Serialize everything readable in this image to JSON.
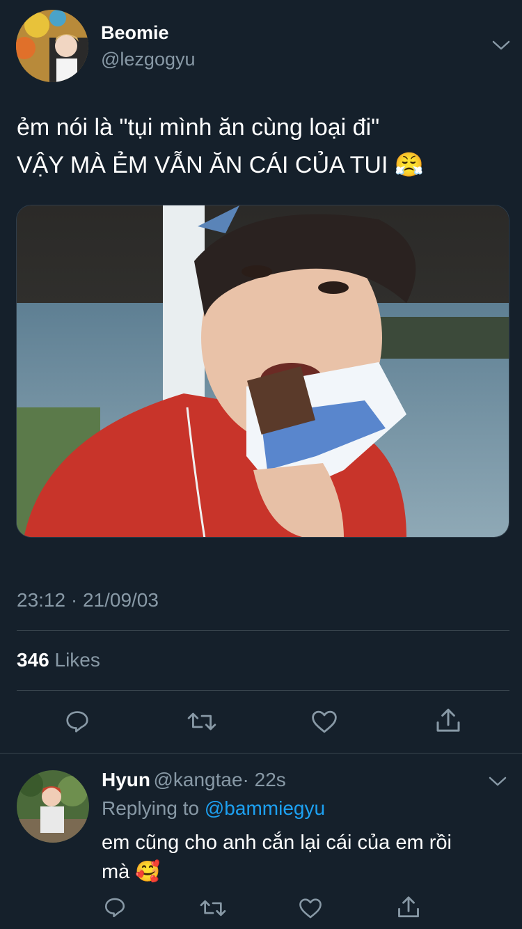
{
  "main_tweet": {
    "author_name": "Beomie",
    "author_handle": "@lezgogyu",
    "text_line1": "ẻm nói là \"tụi mình ăn cùng loại đi\"",
    "text_line2": "VẬY MÀ ẺM VẪN ĂN CÁI CỦA TUI",
    "text_emoji": "😤",
    "timestamp": "23:12 · 21/09/03",
    "likes_count": "346",
    "likes_label": "Likes"
  },
  "reply": {
    "author_name": "Hyun",
    "author_handle": "@kangtae",
    "time": "· 22s",
    "replying_prefix": "Replying to",
    "replying_to": "@bammiegyu",
    "text_line1": "em cũng cho anh cắn lại cái của em rồi",
    "text_line2": "mà",
    "text_emoji": "🥰"
  },
  "colors": {
    "background": "#15202b",
    "secondary_text": "#8899a6",
    "link": "#1da1f2",
    "divider": "#38444d"
  },
  "icons": [
    "reply-icon",
    "retweet-icon",
    "like-icon",
    "share-icon",
    "chevron-down-icon"
  ]
}
